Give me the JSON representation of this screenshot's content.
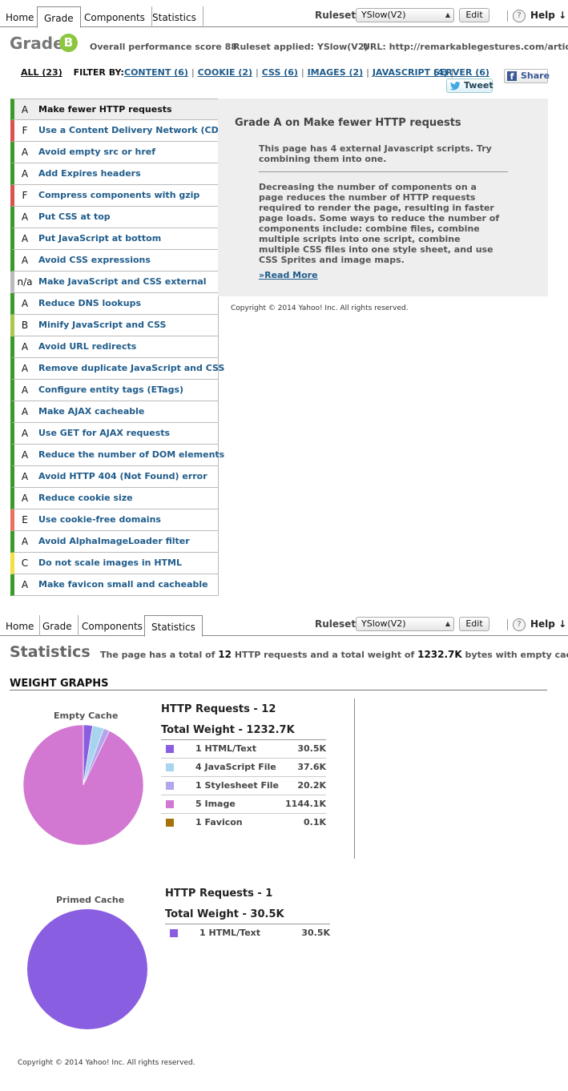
{
  "tabs": [
    {
      "label": "Home"
    },
    {
      "label": "Grade"
    },
    {
      "label": "Components"
    },
    {
      "label": "Statistics"
    }
  ],
  "toolbar": {
    "rulesets_label": "Rulesets",
    "ruleset_value": "YSlow(V2)",
    "edit_label": "Edit",
    "help_label": "Help ↓",
    "help_icon": "?"
  },
  "grade": {
    "title": "Grade",
    "letter": "B",
    "score_text": "Overall performance score 88",
    "ruleset_text": "Ruleset applied: YSlow(V2)",
    "url_text": "URL: http://remarkablegestures.com/articles/t"
  },
  "filters": {
    "all": "ALL (23)",
    "filter_by": "FILTER BY:",
    "items": [
      "CONTENT (6)",
      "COOKIE (2)",
      "CSS (6)",
      "IMAGES (2)",
      "JAVASCRIPT (4)",
      "SERVER (6)"
    ],
    "tweet": "Tweet",
    "share": "Share"
  },
  "rules": [
    {
      "grade": "A",
      "label": "Make fewer HTTP requests",
      "color": "#3a9a2a"
    },
    {
      "grade": "F",
      "label": "Use a Content Delivery Network (CDN)",
      "color": "#d9534f"
    },
    {
      "grade": "A",
      "label": "Avoid empty src or href",
      "color": "#3a9a2a"
    },
    {
      "grade": "A",
      "label": "Add Expires headers",
      "color": "#3a9a2a"
    },
    {
      "grade": "F",
      "label": "Compress components with gzip",
      "color": "#d9534f"
    },
    {
      "grade": "A",
      "label": "Put CSS at top",
      "color": "#3a9a2a"
    },
    {
      "grade": "A",
      "label": "Put JavaScript at bottom",
      "color": "#3a9a2a"
    },
    {
      "grade": "A",
      "label": "Avoid CSS expressions",
      "color": "#3a9a2a"
    },
    {
      "grade": "n/a",
      "label": "Make JavaScript and CSS external",
      "color": "#bbbbbb"
    },
    {
      "grade": "A",
      "label": "Reduce DNS lookups",
      "color": "#3a9a2a"
    },
    {
      "grade": "B",
      "label": "Minify JavaScript and CSS",
      "color": "#a8c94a"
    },
    {
      "grade": "A",
      "label": "Avoid URL redirects",
      "color": "#3a9a2a"
    },
    {
      "grade": "A",
      "label": "Remove duplicate JavaScript and CSS",
      "color": "#3a9a2a"
    },
    {
      "grade": "A",
      "label": "Configure entity tags (ETags)",
      "color": "#3a9a2a"
    },
    {
      "grade": "A",
      "label": "Make AJAX cacheable",
      "color": "#3a9a2a"
    },
    {
      "grade": "A",
      "label": "Use GET for AJAX requests",
      "color": "#3a9a2a"
    },
    {
      "grade": "A",
      "label": "Reduce the number of DOM elements",
      "color": "#3a9a2a"
    },
    {
      "grade": "A",
      "label": "Avoid HTTP 404 (Not Found) error",
      "color": "#3a9a2a"
    },
    {
      "grade": "A",
      "label": "Reduce cookie size",
      "color": "#3a9a2a"
    },
    {
      "grade": "E",
      "label": "Use cookie-free domains",
      "color": "#e8735a"
    },
    {
      "grade": "A",
      "label": "Avoid AlphaImageLoader filter",
      "color": "#3a9a2a"
    },
    {
      "grade": "C",
      "label": "Do not scale images in HTML",
      "color": "#f0e040"
    },
    {
      "grade": "A",
      "label": "Make favicon small and cacheable",
      "color": "#3a9a2a"
    }
  ],
  "detail": {
    "title": "Grade A on Make fewer HTTP requests",
    "summary": "This page has 4 external Javascript scripts. Try combining them into one.",
    "body": "Decreasing the number of components on a page reduces the number of HTTP requests required to render the page, resulting in faster page loads. Some ways to reduce the number of components include: combine files, combine multiple scripts into one script, combine multiple CSS files into one style sheet, and use CSS Sprites and image maps.",
    "read_more": "»Read More"
  },
  "copyright": "Copyright © 2014 Yahoo! Inc. All rights reserved.",
  "stats": {
    "title": "Statistics",
    "summary": {
      "prefix": "The page has a total of",
      "requests": "12",
      "mid": "HTTP requests and a total weight of",
      "weight": "1232.7K",
      "suffix": "bytes with empty cache"
    },
    "weight_graphs": "WEIGHT GRAPHS",
    "empty": {
      "label": "Empty Cache",
      "requests": "HTTP Requests - 12",
      "weight": "Total Weight - 1232.7K"
    },
    "primed": {
      "label": "Primed Cache",
      "requests": "HTTP Requests - 1",
      "weight": "Total Weight - 30.5K"
    }
  },
  "chart_data": [
    {
      "type": "pie",
      "title": "Empty Cache",
      "categories": [
        "HTML/Text",
        "JavaScript File",
        "Stylesheet File",
        "Image",
        "Favicon"
      ],
      "counts": [
        1,
        4,
        1,
        5,
        1
      ],
      "values": [
        30.5,
        37.6,
        20.2,
        1144.1,
        0.1
      ],
      "labels": [
        "1 HTML/Text",
        "4 JavaScript File",
        "1 Stylesheet File",
        "5 Image",
        "1 Favicon"
      ],
      "display_values": [
        "30.5K",
        "37.6K",
        "20.2K",
        "1144.1K",
        "0.1K"
      ],
      "colors": [
        "#8a5ee0",
        "#a8d4ee",
        "#b3a6ec",
        "#d278d2",
        "#a5730e"
      ]
    },
    {
      "type": "pie",
      "title": "Primed Cache",
      "categories": [
        "HTML/Text"
      ],
      "counts": [
        1
      ],
      "values": [
        30.5
      ],
      "labels": [
        "1 HTML/Text"
      ],
      "display_values": [
        "30.5K"
      ],
      "colors": [
        "#8a5ee0"
      ]
    }
  ]
}
